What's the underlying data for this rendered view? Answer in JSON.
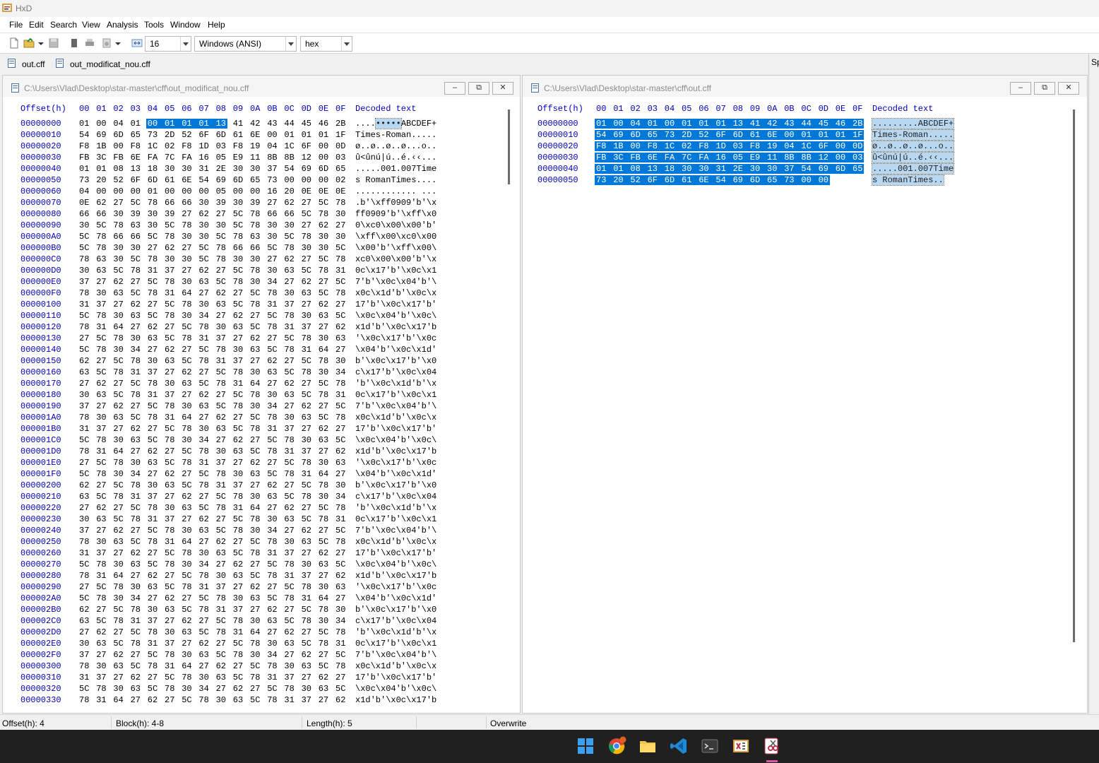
{
  "app": {
    "title": "HxD"
  },
  "menu": [
    "File",
    "Edit",
    "Search",
    "View",
    "Analysis",
    "Tools",
    "Window",
    "Help"
  ],
  "toolbar": {
    "bytes_per_row": "16",
    "charset": "Windows (ANSI)",
    "mode": "hex"
  },
  "tabs": [
    "out.cff",
    "out_modificat_nou.cff"
  ],
  "right_strip": {
    "label": "Sp"
  },
  "left": {
    "path": "C:\\Users\\Vlad\\Desktop\\star-master\\cff\\out_modificat_nou.cff",
    "offset_header": "Offset(h)",
    "decoded_header": "Decoded text",
    "col_headers": [
      "00",
      "01",
      "02",
      "03",
      "04",
      "05",
      "06",
      "07",
      "08",
      "09",
      "0A",
      "0B",
      "0C",
      "0D",
      "0E",
      "0F"
    ],
    "selection": {
      "start": 4,
      "length": 5
    },
    "rows": [
      {
        "o": "00000000",
        "h": "01 00 04 01 00 01 01 01 13 41 42 43 44 45 46 2B",
        "t": "....•••••ABCDEF+"
      },
      {
        "o": "00000010",
        "h": "54 69 6D 65 73 2D 52 6F 6D 61 6E 00 01 01 01 1F",
        "t": "Times-Roman....."
      },
      {
        "o": "00000020",
        "h": "F8 1B 00 F8 1C 02 F8 1D 03 F8 19 04 1C 6F 00 0D",
        "t": "ø..ø..ø..ø...o.."
      },
      {
        "o": "00000030",
        "h": "FB 3C FB 6E FA 7C FA 16 05 E9 11 8B 8B 12 00 03",
        "t": "û<ûnú|ú..é.‹‹..."
      },
      {
        "o": "00000040",
        "h": "01 01 08 13 18 30 30 31 2E 30 30 37 54 69 6D 65",
        "t": ".....001.007Time"
      },
      {
        "o": "00000050",
        "h": "73 20 52 6F 6D 61 6E 54 69 6D 65 73 00 00 00 02",
        "t": "s RomanTimes...."
      },
      {
        "o": "00000060",
        "h": "04 00 00 00 01 00 00 00 05 00 00 16 20 0E 0E 0E",
        "t": "............ ..."
      },
      {
        "o": "00000070",
        "h": "0E 62 27 5C 78 66 66 30 39 30 39 27 62 27 5C 78",
        "t": ".b'\\xff0909'b'\\x"
      },
      {
        "o": "00000080",
        "h": "66 66 30 39 30 39 27 62 27 5C 78 66 66 5C 78 30",
        "t": "ff0909'b'\\xff\\x0"
      },
      {
        "o": "00000090",
        "h": "30 5C 78 63 30 5C 78 30 30 5C 78 30 30 27 62 27",
        "t": "0\\xc0\\x00\\x00'b'"
      },
      {
        "o": "000000A0",
        "h": "5C 78 66 66 5C 78 30 30 5C 78 63 30 5C 78 30 30",
        "t": "\\xff\\x00\\xc0\\x00"
      },
      {
        "o": "000000B0",
        "h": "5C 78 30 30 27 62 27 5C 78 66 66 5C 78 30 30 5C",
        "t": "\\x00'b'\\xff\\x00\\"
      },
      {
        "o": "000000C0",
        "h": "78 63 30 5C 78 30 30 5C 78 30 30 27 62 27 5C 78",
        "t": "xc0\\x00\\x00'b'\\x"
      },
      {
        "o": "000000D0",
        "h": "30 63 5C 78 31 37 27 62 27 5C 78 30 63 5C 78 31",
        "t": "0c\\x17'b'\\x0c\\x1"
      },
      {
        "o": "000000E0",
        "h": "37 27 62 27 5C 78 30 63 5C 78 30 34 27 62 27 5C",
        "t": "7'b'\\x0c\\x04'b'\\"
      },
      {
        "o": "000000F0",
        "h": "78 30 63 5C 78 31 64 27 62 27 5C 78 30 63 5C 78",
        "t": "x0c\\x1d'b'\\x0c\\x"
      },
      {
        "o": "00000100",
        "h": "31 37 27 62 27 5C 78 30 63 5C 78 31 37 27 62 27",
        "t": "17'b'\\x0c\\x17'b'"
      },
      {
        "o": "00000110",
        "h": "5C 78 30 63 5C 78 30 34 27 62 27 5C 78 30 63 5C",
        "t": "\\x0c\\x04'b'\\x0c\\"
      },
      {
        "o": "00000120",
        "h": "78 31 64 27 62 27 5C 78 30 63 5C 78 31 37 27 62",
        "t": "x1d'b'\\x0c\\x17'b"
      },
      {
        "o": "00000130",
        "h": "27 5C 78 30 63 5C 78 31 37 27 62 27 5C 78 30 63",
        "t": "'\\x0c\\x17'b'\\x0c"
      },
      {
        "o": "00000140",
        "h": "5C 78 30 34 27 62 27 5C 78 30 63 5C 78 31 64 27",
        "t": "\\x04'b'\\x0c\\x1d'"
      },
      {
        "o": "00000150",
        "h": "62 27 5C 78 30 63 5C 78 31 37 27 62 27 5C 78 30",
        "t": "b'\\x0c\\x17'b'\\x0"
      },
      {
        "o": "00000160",
        "h": "63 5C 78 31 37 27 62 27 5C 78 30 63 5C 78 30 34",
        "t": "c\\x17'b'\\x0c\\x04"
      },
      {
        "o": "00000170",
        "h": "27 62 27 5C 78 30 63 5C 78 31 64 27 62 27 5C 78",
        "t": "'b'\\x0c\\x1d'b'\\x"
      },
      {
        "o": "00000180",
        "h": "30 63 5C 78 31 37 27 62 27 5C 78 30 63 5C 78 31",
        "t": "0c\\x17'b'\\x0c\\x1"
      },
      {
        "o": "00000190",
        "h": "37 27 62 27 5C 78 30 63 5C 78 30 34 27 62 27 5C",
        "t": "7'b'\\x0c\\x04'b'\\"
      },
      {
        "o": "000001A0",
        "h": "78 30 63 5C 78 31 64 27 62 27 5C 78 30 63 5C 78",
        "t": "x0c\\x1d'b'\\x0c\\x"
      },
      {
        "o": "000001B0",
        "h": "31 37 27 62 27 5C 78 30 63 5C 78 31 37 27 62 27",
        "t": "17'b'\\x0c\\x17'b'"
      },
      {
        "o": "000001C0",
        "h": "5C 78 30 63 5C 78 30 34 27 62 27 5C 78 30 63 5C",
        "t": "\\x0c\\x04'b'\\x0c\\"
      },
      {
        "o": "000001D0",
        "h": "78 31 64 27 62 27 5C 78 30 63 5C 78 31 37 27 62",
        "t": "x1d'b'\\x0c\\x17'b"
      },
      {
        "o": "000001E0",
        "h": "27 5C 78 30 63 5C 78 31 37 27 62 27 5C 78 30 63",
        "t": "'\\x0c\\x17'b'\\x0c"
      },
      {
        "o": "000001F0",
        "h": "5C 78 30 34 27 62 27 5C 78 30 63 5C 78 31 64 27",
        "t": "\\x04'b'\\x0c\\x1d'"
      },
      {
        "o": "00000200",
        "h": "62 27 5C 78 30 63 5C 78 31 37 27 62 27 5C 78 30",
        "t": "b'\\x0c\\x17'b'\\x0"
      },
      {
        "o": "00000210",
        "h": "63 5C 78 31 37 27 62 27 5C 78 30 63 5C 78 30 34",
        "t": "c\\x17'b'\\x0c\\x04"
      },
      {
        "o": "00000220",
        "h": "27 62 27 5C 78 30 63 5C 78 31 64 27 62 27 5C 78",
        "t": "'b'\\x0c\\x1d'b'\\x"
      },
      {
        "o": "00000230",
        "h": "30 63 5C 78 31 37 27 62 27 5C 78 30 63 5C 78 31",
        "t": "0c\\x17'b'\\x0c\\x1"
      },
      {
        "o": "00000240",
        "h": "37 27 62 27 5C 78 30 63 5C 78 30 34 27 62 27 5C",
        "t": "7'b'\\x0c\\x04'b'\\"
      },
      {
        "o": "00000250",
        "h": "78 30 63 5C 78 31 64 27 62 27 5C 78 30 63 5C 78",
        "t": "x0c\\x1d'b'\\x0c\\x"
      },
      {
        "o": "00000260",
        "h": "31 37 27 62 27 5C 78 30 63 5C 78 31 37 27 62 27",
        "t": "17'b'\\x0c\\x17'b'"
      },
      {
        "o": "00000270",
        "h": "5C 78 30 63 5C 78 30 34 27 62 27 5C 78 30 63 5C",
        "t": "\\x0c\\x04'b'\\x0c\\"
      },
      {
        "o": "00000280",
        "h": "78 31 64 27 62 27 5C 78 30 63 5C 78 31 37 27 62",
        "t": "x1d'b'\\x0c\\x17'b"
      },
      {
        "o": "00000290",
        "h": "27 5C 78 30 63 5C 78 31 37 27 62 27 5C 78 30 63",
        "t": "'\\x0c\\x17'b'\\x0c"
      },
      {
        "o": "000002A0",
        "h": "5C 78 30 34 27 62 27 5C 78 30 63 5C 78 31 64 27",
        "t": "\\x04'b'\\x0c\\x1d'"
      },
      {
        "o": "000002B0",
        "h": "62 27 5C 78 30 63 5C 78 31 37 27 62 27 5C 78 30",
        "t": "b'\\x0c\\x17'b'\\x0"
      },
      {
        "o": "000002C0",
        "h": "63 5C 78 31 37 27 62 27 5C 78 30 63 5C 78 30 34",
        "t": "c\\x17'b'\\x0c\\x04"
      },
      {
        "o": "000002D0",
        "h": "27 62 27 5C 78 30 63 5C 78 31 64 27 62 27 5C 78",
        "t": "'b'\\x0c\\x1d'b'\\x"
      },
      {
        "o": "000002E0",
        "h": "30 63 5C 78 31 37 27 62 27 5C 78 30 63 5C 78 31",
        "t": "0c\\x17'b'\\x0c\\x1"
      },
      {
        "o": "000002F0",
        "h": "37 27 62 27 5C 78 30 63 5C 78 30 34 27 62 27 5C",
        "t": "7'b'\\x0c\\x04'b'\\"
      },
      {
        "o": "00000300",
        "h": "78 30 63 5C 78 31 64 27 62 27 5C 78 30 63 5C 78",
        "t": "x0c\\x1d'b'\\x0c\\x"
      },
      {
        "o": "00000310",
        "h": "31 37 27 62 27 5C 78 30 63 5C 78 31 37 27 62 27",
        "t": "17'b'\\x0c\\x17'b'"
      },
      {
        "o": "00000320",
        "h": "5C 78 30 63 5C 78 30 34 27 62 27 5C 78 30 63 5C",
        "t": "\\x0c\\x04'b'\\x0c\\"
      },
      {
        "o": "00000330",
        "h": "78 31 64 27 62 27 5C 78 30 63 5C 78 31 37 27 62",
        "t": "x1d'b'\\x0c\\x17'b"
      }
    ]
  },
  "right": {
    "path": "C:\\Users\\Vlad\\Desktop\\star-master\\cff\\out.cff",
    "offset_header": "Offset(h)",
    "decoded_header": "Decoded text",
    "col_headers": [
      "00",
      "01",
      "02",
      "03",
      "04",
      "05",
      "06",
      "07",
      "08",
      "09",
      "0A",
      "0B",
      "0C",
      "0D",
      "0E",
      "0F"
    ],
    "selection": {
      "start": 0,
      "length": 94
    },
    "rows": [
      {
        "o": "00000000",
        "h": "01 00 04 01 00 01 01 01 13 41 42 43 44 45 46 2B",
        "t": ".........ABCDEF+"
      },
      {
        "o": "00000010",
        "h": "54 69 6D 65 73 2D 52 6F 6D 61 6E 00 01 01 01 1F",
        "t": "Times-Roman....."
      },
      {
        "o": "00000020",
        "h": "F8 1B 00 F8 1C 02 F8 1D 03 F8 19 04 1C 6F 00 0D",
        "t": "ø..ø..ø..ø...o.."
      },
      {
        "o": "00000030",
        "h": "FB 3C FB 6E FA 7C FA 16 05 E9 11 8B 8B 12 00 03",
        "t": "û<ûnú|ú..é.‹‹..."
      },
      {
        "o": "00000040",
        "h": "01 01 08 13 18 30 30 31 2E 30 30 37 54 69 6D 65",
        "t": ".....001.007Time"
      },
      {
        "o": "00000050",
        "h": "73 20 52 6F 6D 61 6E 54 69 6D 65 73 00 00",
        "t": "s RomanTimes.."
      }
    ]
  },
  "status": {
    "offset": "Offset(h): 4",
    "block": "Block(h): 4-8",
    "length": "Length(h): 5",
    "mode": "Overwrite"
  },
  "taskbar": [
    "start-icon",
    "chrome-icon",
    "file-explorer-icon",
    "vscode-icon",
    "terminal-icon",
    "hxd-icon",
    "snipping-tool-icon"
  ],
  "colors": {
    "selection": "#0078d7",
    "offset_text": "#0000b3",
    "taskbar": "#202020"
  }
}
